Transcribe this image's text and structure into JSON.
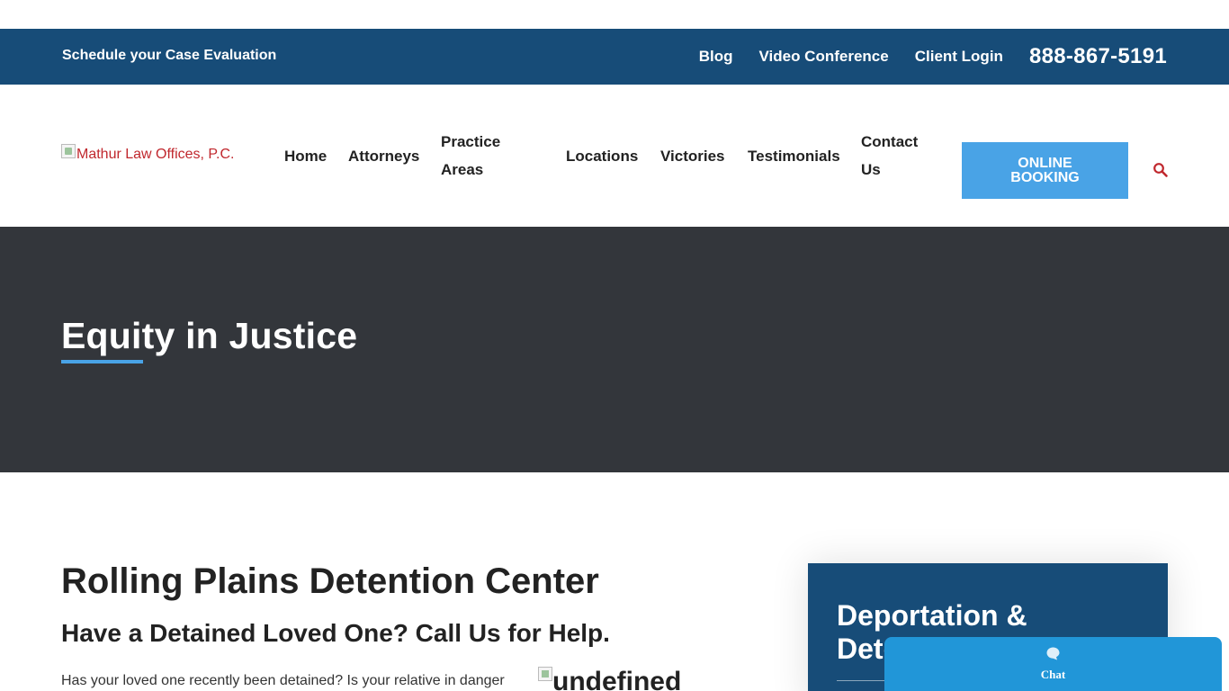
{
  "topbar": {
    "schedule": "Schedule your Case Evaluation",
    "blog": "Blog",
    "video": "Video Conference",
    "login": "Client Login",
    "phone": "888-867-5191"
  },
  "logo": {
    "alt": "Mathur Law Offices, P.C."
  },
  "menu": {
    "home": "Home",
    "attorneys": "Attorneys",
    "practice_1": "Practice",
    "practice_2": "Areas",
    "locations": "Locations",
    "victories": "Victories",
    "testimonials": "Testimonials",
    "contact_1": "Contact",
    "contact_2": "Us",
    "booking_1": "ONLINE",
    "booking_2": "BOOKING",
    "search_icon": "search-icon"
  },
  "hero": {
    "title": "Equity in Justice"
  },
  "content": {
    "heading": "Rolling Plains Detention Center",
    "subheading": "Have a Detained Loved One? Call Us for Help.",
    "paragraph": "Has your loved one recently been detained? Is your relative in danger of",
    "image_alt": "undefined"
  },
  "sidebar": {
    "title": "Deportation & Detention"
  },
  "chat": {
    "label": "Chat"
  },
  "colors": {
    "primary": "#174c78",
    "accent": "#49a3e6",
    "hero_bg": "#33363b",
    "logo_red": "#c0272d",
    "chat": "#2196d8"
  }
}
